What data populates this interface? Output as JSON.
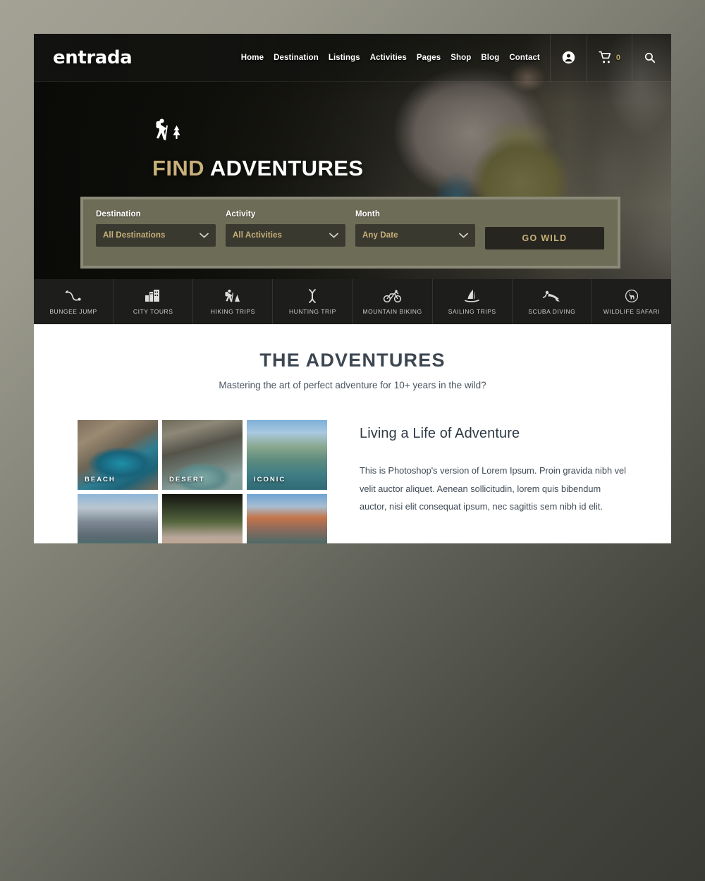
{
  "site": {
    "logo": "entrada"
  },
  "nav": {
    "items": [
      {
        "label": "Home"
      },
      {
        "label": "Destination"
      },
      {
        "label": "Listings"
      },
      {
        "label": "Activities"
      },
      {
        "label": "Pages"
      },
      {
        "label": "Shop"
      },
      {
        "label": "Blog"
      },
      {
        "label": "Contact"
      }
    ],
    "account_icon": "account-circle-icon",
    "cart_icon": "shopping-cart-icon",
    "cart_count": "0",
    "search_icon": "search-icon"
  },
  "hero": {
    "icon": "hiker-tree-icon",
    "title_gold": "FIND",
    "title_white": "ADVENTURES",
    "search": {
      "destination": {
        "label": "Destination",
        "value": "All Destinations",
        "chevron": "chevron-down-icon"
      },
      "activity": {
        "label": "Activity",
        "value": "All Activities",
        "chevron": "chevron-down-icon"
      },
      "month": {
        "label": "Month",
        "value": "Any Date",
        "chevron": "chevron-down-icon"
      },
      "submit_label": "GO WILD"
    }
  },
  "categories": [
    {
      "label": "BUNGEE JUMP",
      "icon": "bungee-cord-icon"
    },
    {
      "label": "CITY TOURS",
      "icon": "city-buildings-icon"
    },
    {
      "label": "HIKING TRIPS",
      "icon": "hiker-icon"
    },
    {
      "label": "HUNTING TRIP",
      "icon": "hunting-bow-icon"
    },
    {
      "label": "MOUNTAIN BIKING",
      "icon": "bicycle-icon"
    },
    {
      "label": "SAILING TRIPS",
      "icon": "sailboat-icon"
    },
    {
      "label": "SCUBA DIVING",
      "icon": "scuba-diver-icon"
    },
    {
      "label": "WILDLIFE SAFARI",
      "icon": "wildlife-circle-icon"
    }
  ],
  "adventures": {
    "title": "THE ADVENTURES",
    "subtitle": "Mastering the art of perfect adventure for 10+ years in the wild?",
    "gallery": [
      {
        "label": "BEACH"
      },
      {
        "label": "DESERT"
      },
      {
        "label": "ICONIC"
      },
      {
        "label": ""
      },
      {
        "label": ""
      },
      {
        "label": ""
      }
    ],
    "article": {
      "title": "Living a Life of Adventure",
      "body": "This is Photoshop's version of Lorem Ipsum. Proin gravida nibh vel velit auctor aliquet. Aenean sollicitudin, lorem quis bibendum auctor, nisi elit consequat ipsum, nec sagittis sem nibh id elit."
    }
  },
  "colors": {
    "gold": "#c8b178",
    "panel_olive": "#6d6c57",
    "panel_border": "#8b8a78",
    "dark": "#1d1d1b",
    "heading": "#3c4650"
  }
}
